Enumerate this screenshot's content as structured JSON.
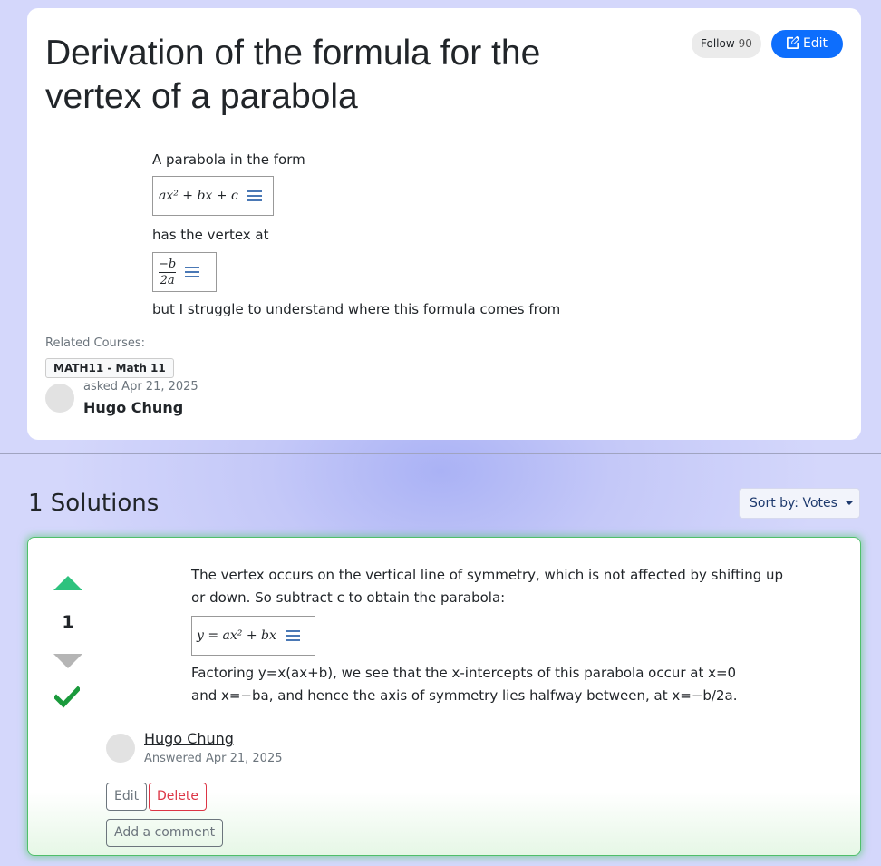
{
  "question": {
    "title": "Derivation of the formula for the vertex of a parabola",
    "follow_label": "Follow",
    "follow_count": "90",
    "edit_label": "Edit",
    "body": {
      "line1": "A parabola in the form",
      "math1": "ax² + bx + c",
      "line2": "has the vertex at",
      "math2_num": "−b",
      "math2_den": "2a",
      "line3": "but I struggle to understand where this formula comes from"
    },
    "related_label": "Related Courses:",
    "course": "MATH11 - Math 11",
    "asked_meta": "asked Apr 21, 2025",
    "author": "Hugo Chung"
  },
  "solutions": {
    "heading": "1 Solutions",
    "sort_prefix": "Sort by:",
    "sort_value": "Votes"
  },
  "answer": {
    "votes": "1",
    "para1": "The vertex occurs on the vertical line of symmetry, which is not affected by shifting up or down. So subtract c to obtain the parabola:",
    "math": "y = ax² + bx",
    "para2": "Factoring y=x(ax+b), we see that the x-intercepts of this parabola occur at x=0 and x=−ba, and hence the axis of symmetry lies halfway between, at x=−b/2a.",
    "author": "Hugo Chung",
    "date": "Answered Apr 21, 2025",
    "edit_label": "Edit",
    "delete_label": "Delete",
    "comment_label": "Add a comment"
  },
  "colors": {
    "primary": "#0d6efd",
    "upvote": "#2ec27e",
    "accepted": "#1a9a3c",
    "danger": "#dc3545"
  },
  "icons": {
    "edit": "pencil-square-icon",
    "menu": "hamburger-icon",
    "accepted": "checkmark-icon",
    "caret": "caret-down-icon"
  }
}
